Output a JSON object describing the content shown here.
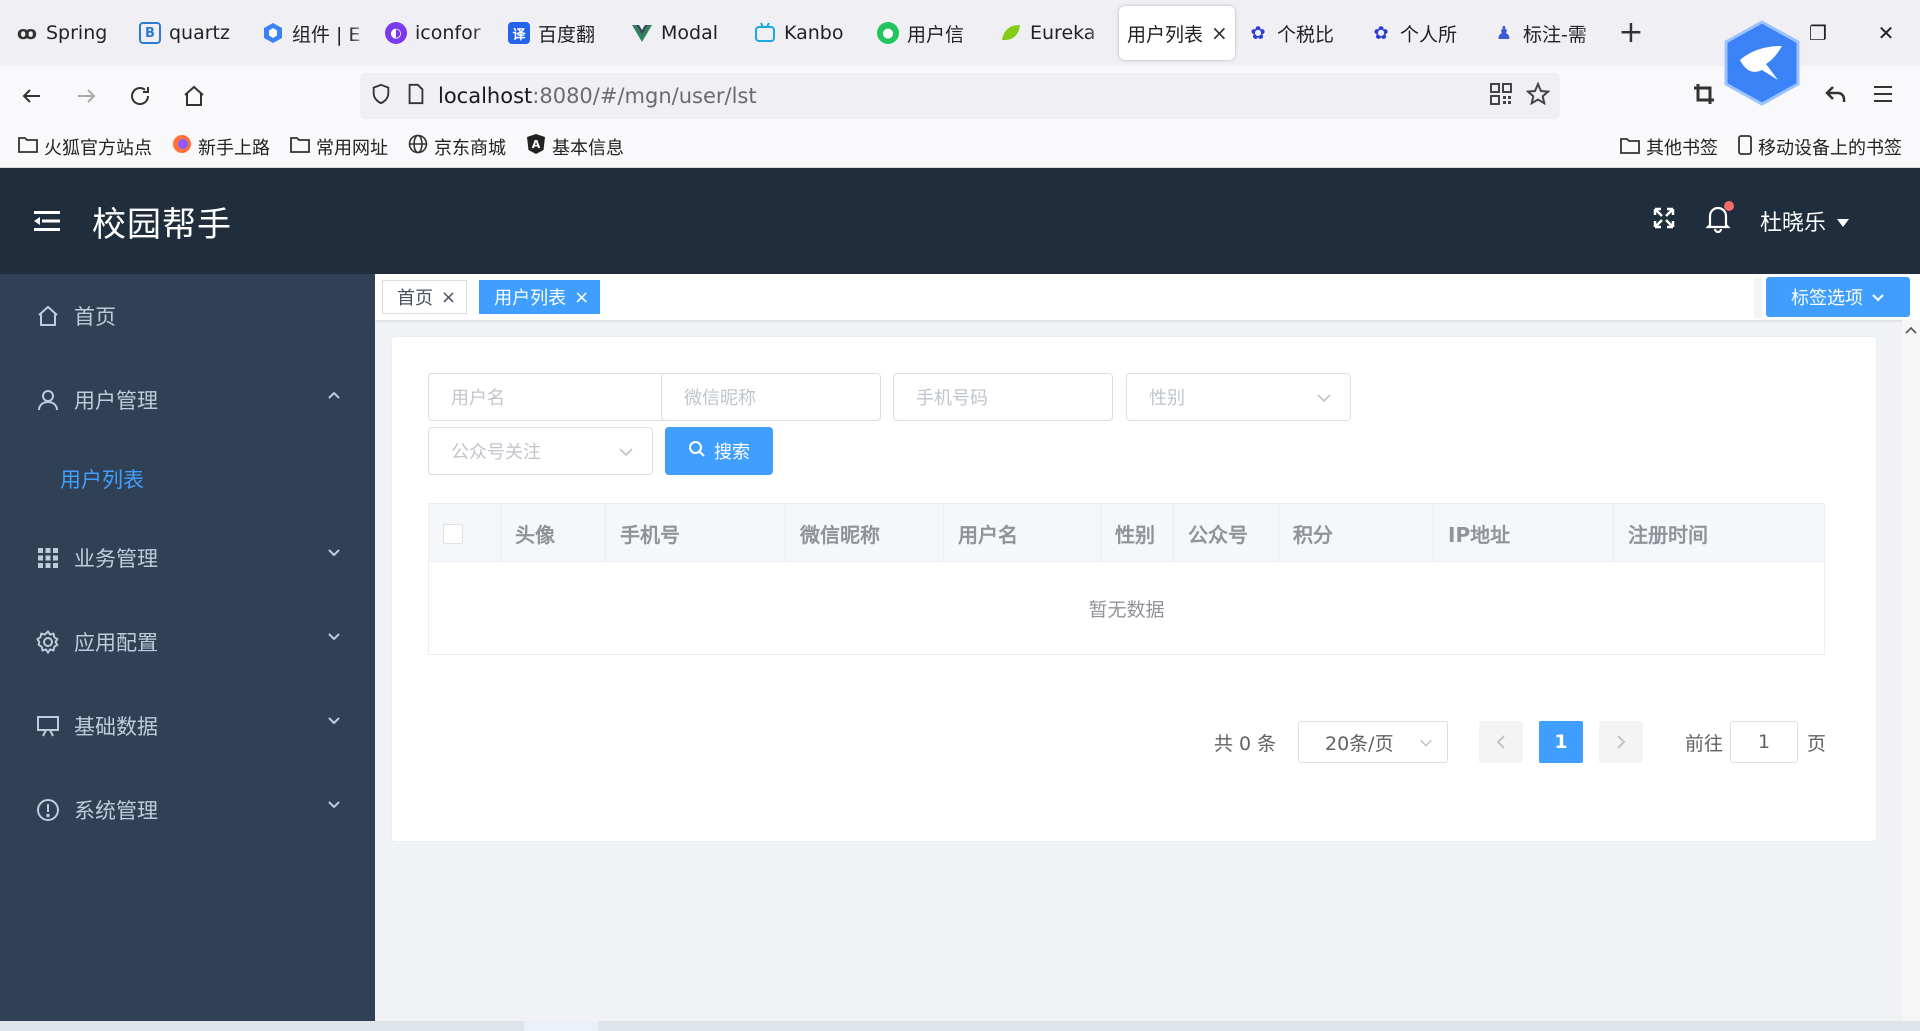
{
  "browser": {
    "tabs": [
      {
        "label": "Spring",
        "color": "#333333"
      },
      {
        "label": "quartz",
        "color": "#2b7bd6"
      },
      {
        "label": "组件 | E",
        "color": "#3b82f6"
      },
      {
        "label": "iconfor",
        "color": "#7c3aed"
      },
      {
        "label": "百度翻",
        "color": "#2563eb"
      },
      {
        "label": "Modal",
        "color": "#2f855a"
      },
      {
        "label": "Kanbo",
        "color": "#1ea7e1"
      },
      {
        "label": "用户信",
        "color": "#22c55e"
      },
      {
        "label": "Eureka",
        "color": "#84cc16"
      },
      {
        "label": "用户列表",
        "color": "#ffffff"
      },
      {
        "label": "个税比",
        "color": "#2b3bd6"
      },
      {
        "label": "个人所",
        "color": "#2b3bd6"
      },
      {
        "label": "标注-需",
        "color": "#3b5bd6"
      }
    ],
    "url_host": "localhost",
    "url_path": ":8080/#/mgn/user/lst",
    "bookmarks": [
      "火狐官方站点",
      "新手上路",
      "常用网址",
      "京东商城",
      "基本信息"
    ],
    "bookmarks_right": [
      "其他书签",
      "移动设备上的书签"
    ]
  },
  "app": {
    "title": "校园帮手",
    "user": "杜晓乐",
    "accent": "#409eff",
    "header_bg": "#1f2d3d",
    "sidebar_bg": "#304156"
  },
  "sidebar": {
    "items": [
      {
        "label": "首页",
        "icon": "home-icon"
      },
      {
        "label": "用户管理",
        "icon": "user-icon",
        "expanded": true
      },
      {
        "label": "业务管理",
        "icon": "grid-icon"
      },
      {
        "label": "应用配置",
        "icon": "gear-icon"
      },
      {
        "label": "基础数据",
        "icon": "board-icon"
      },
      {
        "label": "系统管理",
        "icon": "info-icon"
      }
    ],
    "sub_item": "用户列表"
  },
  "tags": {
    "items": [
      "首页",
      "用户列表"
    ],
    "active": "用户列表",
    "options_label": "标签选项"
  },
  "filters": {
    "username_placeholder": "用户名",
    "nickname_placeholder": "微信昵称",
    "phone_placeholder": "手机号码",
    "gender_placeholder": "性别",
    "follow_placeholder": "公众号关注",
    "search_label": "搜索"
  },
  "table": {
    "columns": [
      "头像",
      "手机号",
      "微信昵称",
      "用户名",
      "性别",
      "公众号",
      "积分",
      "IP地址",
      "注册时间"
    ],
    "empty_text": "暂无数据"
  },
  "pagination": {
    "total_text": "共 0 条",
    "page_size": "20条/页",
    "current_page": "1",
    "goto_prefix": "前往",
    "goto_value": "1",
    "goto_suffix": "页"
  }
}
